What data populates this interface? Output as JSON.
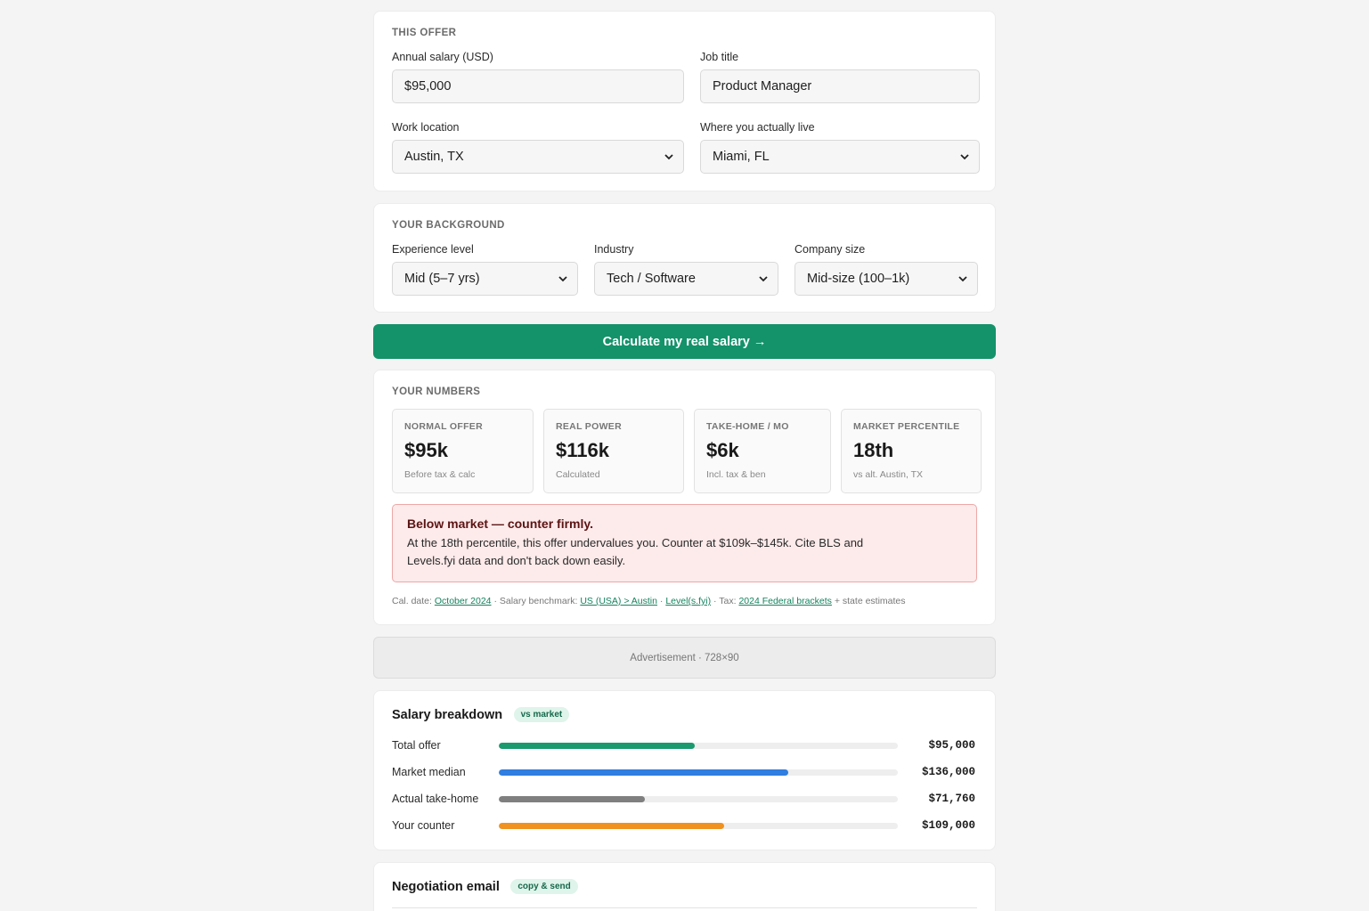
{
  "offer": {
    "section_label": "THIS OFFER",
    "salary_label": "Annual salary (USD)",
    "salary_value": "$95,000",
    "title_label": "Job title",
    "title_value": "Product Manager",
    "work_label": "Work location",
    "work_value": "Austin, TX",
    "live_label": "Where you actually live",
    "live_value": "Miami, FL"
  },
  "background": {
    "section_label": "YOUR BACKGROUND",
    "experience_label": "Experience level",
    "experience_value": "Mid (5–7 yrs)",
    "industry_label": "Industry",
    "industry_value": "Tech / Software",
    "size_label": "Company size",
    "size_value": "Mid-size (100–1k)"
  },
  "cta": {
    "label": "Calculate my real salary →"
  },
  "numbers": {
    "section_label": "YOUR NUMBERS",
    "stats": [
      {
        "label": "NORMAL OFFER",
        "value": "$95k",
        "sub": "Before tax & calc"
      },
      {
        "label": "REAL POWER",
        "value": "$116k",
        "sub": "Calculated"
      },
      {
        "label": "TAKE-HOME / MO",
        "value": "$6k",
        "sub": "Incl. tax & ben"
      },
      {
        "label": "MARKET PERCENTILE",
        "value": "18th",
        "sub": "vs alt. Austin, TX"
      }
    ],
    "alert_title": "Below market — counter firmly.",
    "alert_body": "At the 18th percentile, this offer undervalues you. Counter at $109k–$145k. Cite BLS and Levels.fyi data and don't back down easily.",
    "meta": {
      "date_label": "Cal. date:",
      "date_link": "October 2024",
      "sep": "·",
      "bench_label": "Salary benchmark:",
      "bench_link1": "US (USA) > Austin",
      "bench_link2": "Level(s.fyi)",
      "tax_label": "Tax:",
      "tax_link": "2024 Federal brackets",
      "tax_suffix": "+ state estimates"
    }
  },
  "ad": {
    "label": "Advertisement · 728×90"
  },
  "breakdown": {
    "title": "Salary breakdown",
    "badge": "vs market",
    "rows": [
      {
        "label": "Total offer",
        "value": "$95,000",
        "fill": 0.49,
        "color": "#1a9a6e"
      },
      {
        "label": "Market median",
        "value": "$136,000",
        "fill": 0.725,
        "color": "#2f7ee0"
      },
      {
        "label": "Actual take-home",
        "value": "$71,760",
        "fill": 0.365,
        "color": "#7f7f7f"
      },
      {
        "label": "Your counter",
        "value": "$109,000",
        "fill": 0.565,
        "color": "#f0921f"
      }
    ]
  },
  "email": {
    "title": "Negotiation email",
    "badge": "copy & send"
  }
}
